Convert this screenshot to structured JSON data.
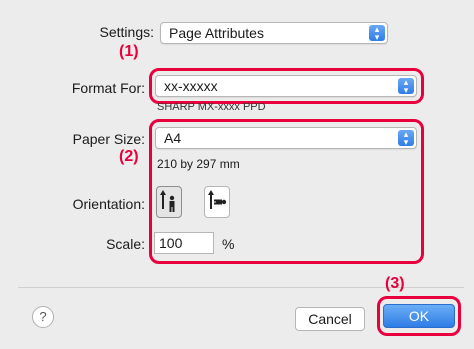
{
  "settings": {
    "label": "Settings:",
    "value": "Page Attributes"
  },
  "format_for": {
    "label": "Format For:",
    "value": "xx-xxxxx",
    "subtitle": "SHARP MX-xxxx PPD"
  },
  "paper_size": {
    "label": "Paper Size:",
    "value": "A4",
    "dimensions": "210 by 297 mm"
  },
  "orientation": {
    "label": "Orientation:",
    "selected": "portrait"
  },
  "scale": {
    "label": "Scale:",
    "value": "100",
    "unit": "%"
  },
  "buttons": {
    "help": "?",
    "cancel": "Cancel",
    "ok": "OK"
  },
  "annotations": {
    "step1": "(1)",
    "step2": "(2)",
    "step3": "(3)",
    "color": "#e8003c"
  },
  "icons": {
    "popup_stepper": "up-down-chevron-icon",
    "portrait": "portrait-orientation-icon",
    "landscape": "landscape-orientation-icon"
  }
}
